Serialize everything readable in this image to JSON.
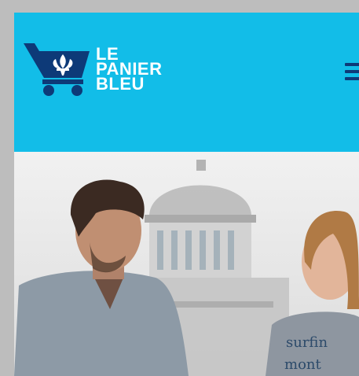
{
  "header": {
    "brand_line1": "LE",
    "brand_line2": "PANIER",
    "brand_line3": "BLEU",
    "background": "#12bde8",
    "brand_color": "#0d3a78",
    "logo_icon": "shopping-cart-fleur-de-lis-icon",
    "menu_icon": "hamburger-menu-icon"
  },
  "hero": {
    "shirt_text_line1": "surfin",
    "shirt_text_line2": "mont"
  }
}
